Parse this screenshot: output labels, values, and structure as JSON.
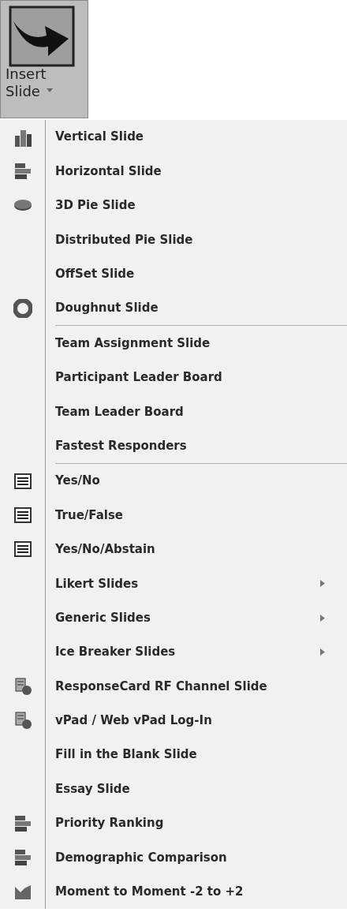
{
  "ribbon_button": {
    "label": "Insert Slide"
  },
  "menu": {
    "groups": [
      {
        "items": [
          {
            "label": "Vertical Slide",
            "kind": "column",
            "submenu": false
          },
          {
            "label": "Horizontal Slide",
            "kind": "bar",
            "submenu": false
          },
          {
            "label": "3D Pie Slide",
            "kind": "pie",
            "submenu": false
          },
          {
            "label": "Distributed Pie Slide",
            "kind": "plain",
            "submenu": false
          },
          {
            "label": "OffSet Slide",
            "kind": "plain",
            "submenu": false
          },
          {
            "label": "Doughnut Slide",
            "kind": "donut",
            "submenu": false
          }
        ]
      },
      {
        "items": [
          {
            "label": "Team Assignment Slide",
            "kind": "plain",
            "submenu": false
          },
          {
            "label": "Participant Leader Board",
            "kind": "plain",
            "submenu": false
          },
          {
            "label": "Team Leader Board",
            "kind": "plain",
            "submenu": false
          },
          {
            "label": "Fastest Responders",
            "kind": "plain",
            "submenu": false
          }
        ]
      },
      {
        "items": [
          {
            "label": "Yes/No",
            "kind": "list",
            "submenu": false
          },
          {
            "label": "True/False",
            "kind": "list",
            "submenu": false
          },
          {
            "label": "Yes/No/Abstain",
            "kind": "list",
            "submenu": false
          },
          {
            "label": "Likert Slides",
            "kind": "plain",
            "submenu": true
          },
          {
            "label": "Generic Slides",
            "kind": "plain",
            "submenu": true
          },
          {
            "label": "Ice Breaker Slides",
            "kind": "plain",
            "submenu": true
          },
          {
            "label": "ResponseCard RF Channel Slide",
            "kind": "card",
            "submenu": false
          },
          {
            "label": "vPad / Web vPad Log-In",
            "kind": "card",
            "submenu": false
          },
          {
            "label": "Fill in the Blank Slide",
            "kind": "plain",
            "submenu": false
          },
          {
            "label": "Essay Slide",
            "kind": "plain",
            "submenu": false
          },
          {
            "label": "Priority Ranking",
            "kind": "bar",
            "submenu": false
          },
          {
            "label": "Demographic Comparison",
            "kind": "bar",
            "submenu": false
          },
          {
            "label": "Moment to Moment -2 to +2",
            "kind": "area",
            "submenu": false
          }
        ]
      }
    ]
  }
}
